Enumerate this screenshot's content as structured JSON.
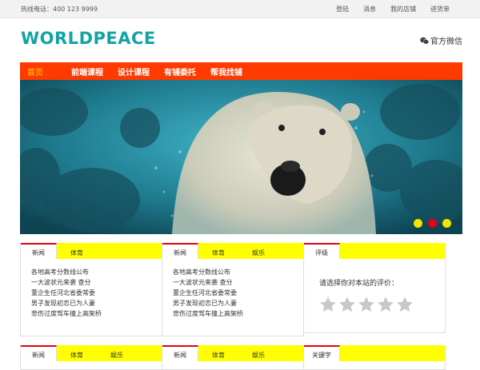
{
  "topbar": {
    "hotline": "热线电话：400 123 9999",
    "links": [
      "登陆",
      "消息",
      "我的店铺",
      "进货单"
    ]
  },
  "header": {
    "logo": "WORLDPEACE",
    "wechat": "官方微信"
  },
  "nav": {
    "items": [
      "首页",
      "前端课程",
      "设计课程",
      "有铺委托",
      "帮我找铺"
    ]
  },
  "banner": {
    "dots": 3,
    "active_dot": 1
  },
  "panels_row1": [
    {
      "tabs": [
        "新闻",
        "体育"
      ],
      "items": [
        "各地高考分数线公布",
        "一大波状元来袭 查分",
        "董企生任河北省委常委",
        "男子发现初恋已为人妻",
        "悲伤过度驾车撞上高架桥"
      ]
    },
    {
      "tabs": [
        "新闻",
        "体育",
        "娱乐"
      ],
      "items": [
        "各地高考分数线公布",
        "一大波状元来袭 查分",
        "董企生任河北省委常委",
        "男子发现初恋已为人妻",
        "悲伤过度驾车撞上高架桥"
      ]
    },
    {
      "tabs": [
        "评级"
      ],
      "prompt": "请选择你对本站的评价：",
      "stars": 5
    }
  ],
  "panels_row2": [
    {
      "tabs": [
        "新闻",
        "体育",
        "娱乐"
      ]
    },
    {
      "tabs": [
        "新闻",
        "体育",
        "娱乐"
      ]
    },
    {
      "tabs": [
        "关键字"
      ]
    }
  ],
  "colors": {
    "nav_bg": "#ff3a00",
    "tab_bg": "#ffff00",
    "logo": "#14a3a3",
    "active_dot": "#e8001c"
  }
}
